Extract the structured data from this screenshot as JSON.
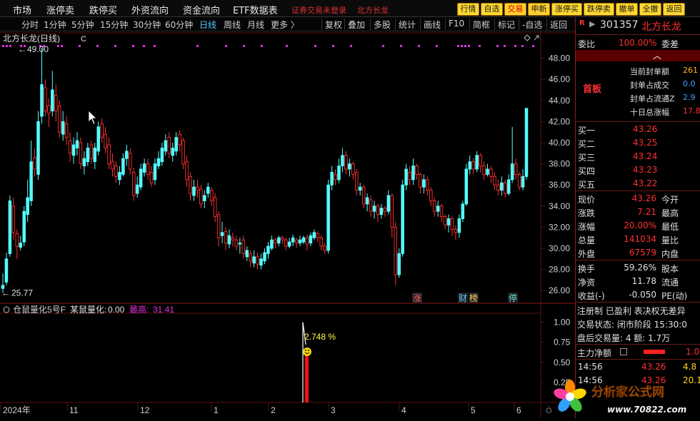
{
  "top_nav": {
    "items": [
      "市场",
      "涨停卖",
      "跌停买",
      "外资流向",
      "资金流向",
      "ETF数据表"
    ],
    "status_text": "证券交易未登录",
    "stock_short": "北方长龙",
    "buttons": [
      "行情",
      "自选",
      "交易",
      "申新",
      "涨停买",
      "跌停卖",
      "撤单",
      "全撤",
      "返回"
    ]
  },
  "toolbar": {
    "periods": [
      "分时",
      "1分钟",
      "5分钟",
      "15分钟",
      "30分钟",
      "60分钟",
      "日线",
      "周线",
      "月线",
      "更多 〉"
    ],
    "active_period": "日线",
    "tools": [
      "复权",
      "叠加",
      "多股",
      "统计",
      "画线",
      "F10",
      "简框",
      "标记",
      "-自选",
      "返回"
    ]
  },
  "chart": {
    "title": "北方长龙(日线)",
    "title_suffix": "C",
    "high_label": "49.00",
    "low_label": "25.77",
    "y_ticks": [
      "48.00",
      "46.00",
      "44.00",
      "42.00",
      "40.00",
      "38.00",
      "36.00",
      "34.00",
      "32.00",
      "30.00",
      "28.00",
      "26.00"
    ],
    "event_tags": [
      "涨",
      "财",
      "榜",
      "停"
    ],
    "x_labels": [
      "2024年",
      "11",
      "12",
      "1",
      "2",
      "3",
      "4",
      "5",
      "6"
    ],
    "indicator_title": "仓鼠量化5号F",
    "indicator_name": "某鼠量化:",
    "indicator_value": "0.00",
    "indicator_high_label": "最高:",
    "indicator_high": "31.41",
    "indicator_ticks": [
      "1.00",
      "0.75",
      "0.50",
      "0.25"
    ],
    "indicator_annotation": "2.748 %",
    "bottom_right_tick": "Ò"
  },
  "chart_data": {
    "type": "candlestick",
    "title": "北方长龙(日线)",
    "ylim": [
      25.0,
      50.0
    ],
    "candles": [
      [
        26.5,
        26.2,
        27.6,
        25.77
      ],
      [
        29.0,
        26.8,
        29.6,
        26.5
      ],
      [
        34.5,
        29.5,
        35.0,
        29.2
      ],
      [
        31.5,
        34.0,
        34.8,
        30.8
      ],
      [
        30.2,
        31.4,
        31.8,
        29.0
      ],
      [
        30.5,
        30.1,
        31.2,
        29.8
      ],
      [
        33.5,
        30.6,
        34.0,
        30.2
      ],
      [
        34.8,
        33.2,
        36.5,
        32.5
      ],
      [
        38.2,
        34.5,
        40.2,
        34.0
      ],
      [
        37.5,
        38.6,
        39.5,
        36.8
      ],
      [
        42.0,
        37.0,
        43.0,
        36.5
      ],
      [
        45.5,
        42.5,
        49.0,
        41.8
      ],
      [
        43.0,
        45.2,
        46.0,
        42.5
      ],
      [
        42.8,
        43.5,
        44.2,
        41.5
      ],
      [
        45.0,
        43.0,
        46.8,
        42.5
      ],
      [
        43.0,
        44.5,
        45.5,
        42.0
      ],
      [
        41.0,
        43.5,
        44.0,
        40.5
      ],
      [
        42.0,
        40.8,
        43.0,
        40.2
      ],
      [
        40.5,
        41.8,
        42.5,
        39.8
      ],
      [
        39.0,
        40.2,
        41.0,
        38.2
      ],
      [
        39.8,
        38.8,
        40.5,
        38.0
      ],
      [
        40.2,
        39.5,
        41.0,
        38.8
      ],
      [
        38.0,
        40.0,
        40.5,
        37.5
      ],
      [
        38.5,
        37.8,
        39.2,
        37.0
      ],
      [
        39.5,
        38.2,
        40.0,
        37.8
      ],
      [
        38.5,
        39.8,
        40.2,
        38.0
      ],
      [
        39.5,
        38.2,
        40.0,
        37.5
      ],
      [
        41.5,
        39.2,
        42.0,
        38.8
      ],
      [
        40.5,
        41.8,
        42.3,
        40.0
      ],
      [
        39.5,
        40.8,
        41.5,
        39.0
      ],
      [
        38.0,
        39.8,
        40.5,
        37.5
      ],
      [
        37.5,
        38.2,
        39.0,
        36.8
      ],
      [
        36.8,
        37.8,
        38.2,
        36.2
      ],
      [
        37.2,
        36.5,
        37.8,
        36.0
      ],
      [
        38.5,
        37.0,
        39.0,
        36.8
      ],
      [
        39.2,
        38.5,
        39.8,
        37.8
      ],
      [
        37.5,
        39.0,
        39.5,
        37.0
      ],
      [
        35.0,
        37.2,
        37.6,
        34.5
      ],
      [
        36.0,
        35.2,
        36.8,
        34.8
      ],
      [
        37.5,
        35.8,
        38.0,
        35.5
      ],
      [
        38.0,
        37.2,
        38.5,
        36.8
      ],
      [
        37.0,
        38.0,
        38.5,
        36.5
      ],
      [
        36.2,
        37.2,
        37.8,
        35.8
      ],
      [
        38.0,
        36.5,
        38.5,
        36.0
      ],
      [
        38.5,
        37.8,
        39.2,
        37.5
      ],
      [
        39.5,
        38.2,
        40.0,
        37.8
      ],
      [
        40.2,
        39.2,
        40.8,
        38.8
      ],
      [
        39.0,
        40.5,
        41.0,
        38.5
      ],
      [
        39.5,
        38.8,
        40.0,
        38.2
      ],
      [
        40.5,
        39.2,
        41.0,
        38.8
      ],
      [
        39.8,
        40.8,
        41.2,
        39.2
      ],
      [
        38.0,
        40.2,
        40.5,
        37.5
      ],
      [
        36.5,
        38.2,
        38.8,
        35.8
      ],
      [
        35.2,
        36.8,
        37.2,
        34.5
      ],
      [
        35.8,
        35.0,
        36.5,
        34.5
      ],
      [
        35.5,
        35.8,
        36.5,
        34.8
      ],
      [
        34.2,
        35.6,
        36.0,
        33.8
      ],
      [
        35.0,
        34.5,
        35.5,
        33.8
      ],
      [
        35.8,
        35.2,
        36.2,
        34.8
      ],
      [
        34.5,
        35.5,
        35.8,
        34.0
      ],
      [
        33.0,
        34.8,
        35.2,
        32.5
      ],
      [
        31.0,
        33.2,
        33.5,
        30.2
      ],
      [
        31.5,
        31.2,
        32.5,
        30.5
      ],
      [
        30.5,
        31.6,
        32.0,
        29.8
      ],
      [
        31.2,
        30.4,
        31.8,
        30.0
      ],
      [
        30.8,
        31.0,
        31.5,
        30.2
      ],
      [
        30.2,
        30.8,
        31.2,
        29.8
      ],
      [
        30.5,
        30.4,
        31.0,
        29.5
      ],
      [
        29.5,
        30.8,
        31.2,
        29.0
      ],
      [
        29.8,
        29.2,
        30.2,
        28.8
      ],
      [
        28.8,
        29.5,
        29.8,
        28.2
      ],
      [
        29.2,
        28.6,
        29.8,
        28.2
      ],
      [
        28.5,
        29.2,
        29.6,
        28.0
      ],
      [
        29.0,
        28.4,
        29.5,
        28.0
      ],
      [
        29.6,
        28.8,
        30.0,
        28.5
      ],
      [
        30.2,
        29.5,
        30.6,
        29.0
      ],
      [
        30.8,
        30.0,
        31.2,
        29.8
      ],
      [
        30.5,
        30.8,
        31.0,
        30.0
      ],
      [
        31.0,
        30.5,
        31.2,
        30.2
      ],
      [
        30.8,
        31.0,
        31.2,
        30.4
      ],
      [
        30.2,
        30.8,
        31.0,
        29.8
      ],
      [
        30.6,
        30.2,
        31.0,
        30.0
      ],
      [
        31.0,
        30.6,
        31.3,
        30.2
      ],
      [
        30.5,
        30.8,
        31.0,
        30.0
      ],
      [
        30.8,
        30.5,
        31.2,
        30.2
      ],
      [
        31.0,
        30.6,
        31.2,
        30.4
      ],
      [
        30.4,
        31.0,
        31.3,
        29.8
      ],
      [
        31.2,
        30.5,
        31.5,
        30.2
      ],
      [
        31.5,
        31.0,
        31.8,
        30.8
      ],
      [
        31.0,
        31.4,
        31.6,
        30.6
      ],
      [
        30.2,
        31.0,
        31.2,
        29.8
      ],
      [
        29.8,
        30.2,
        30.5,
        29.5
      ],
      [
        36.0,
        29.8,
        36.5,
        29.5
      ],
      [
        37.2,
        36.0,
        37.8,
        35.5
      ],
      [
        36.5,
        37.0,
        37.5,
        36.0
      ],
      [
        37.8,
        36.5,
        38.5,
        36.2
      ],
      [
        38.8,
        37.8,
        39.5,
        37.2
      ],
      [
        37.5,
        38.8,
        39.2,
        37.0
      ],
      [
        38.0,
        37.5,
        38.5,
        36.8
      ],
      [
        37.0,
        38.0,
        38.2,
        36.5
      ],
      [
        35.5,
        37.2,
        37.5,
        35.0
      ],
      [
        35.8,
        35.5,
        36.2,
        35.0
      ],
      [
        34.2,
        35.8,
        36.0,
        33.8
      ],
      [
        34.8,
        34.2,
        35.2,
        33.5
      ],
      [
        33.5,
        34.6,
        35.0,
        33.0
      ],
      [
        34.0,
        33.5,
        34.5,
        32.8
      ],
      [
        33.2,
        34.0,
        34.2,
        32.5
      ],
      [
        33.8,
        33.2,
        34.2,
        32.8
      ],
      [
        33.5,
        33.8,
        34.0,
        33.0
      ],
      [
        35.0,
        33.5,
        35.5,
        33.2
      ],
      [
        32.0,
        35.0,
        35.2,
        31.0
      ],
      [
        27.5,
        32.0,
        32.5,
        26.5
      ],
      [
        29.5,
        27.5,
        30.0,
        27.2
      ],
      [
        36.0,
        29.5,
        36.5,
        29.2
      ],
      [
        37.5,
        36.0,
        38.0,
        35.5
      ],
      [
        36.5,
        37.2,
        37.8,
        36.0
      ],
      [
        37.8,
        36.5,
        38.5,
        36.0
      ],
      [
        37.0,
        37.8,
        38.0,
        36.5
      ],
      [
        35.8,
        37.0,
        37.2,
        35.2
      ],
      [
        36.5,
        35.8,
        37.0,
        35.2
      ],
      [
        35.5,
        36.5,
        36.8,
        35.0
      ],
      [
        34.5,
        35.5,
        35.8,
        34.0
      ],
      [
        33.5,
        34.5,
        34.8,
        33.0
      ],
      [
        34.0,
        33.5,
        34.5,
        33.0
      ],
      [
        33.0,
        34.0,
        34.2,
        32.5
      ],
      [
        32.2,
        33.0,
        33.2,
        31.8
      ],
      [
        32.8,
        32.2,
        33.2,
        31.5
      ],
      [
        31.8,
        32.8,
        33.0,
        31.2
      ],
      [
        31.5,
        31.8,
        32.2,
        30.8
      ],
      [
        32.8,
        31.5,
        33.2,
        31.0
      ],
      [
        34.2,
        32.8,
        34.5,
        32.5
      ],
      [
        37.5,
        34.2,
        38.0,
        34.0
      ],
      [
        38.2,
        37.5,
        38.8,
        37.0
      ],
      [
        37.5,
        38.2,
        38.5,
        37.0
      ],
      [
        38.8,
        37.5,
        39.2,
        37.2
      ],
      [
        37.8,
        38.8,
        39.0,
        37.2
      ],
      [
        37.0,
        37.8,
        38.2,
        36.5
      ],
      [
        37.5,
        37.0,
        38.0,
        36.8
      ],
      [
        36.8,
        37.5,
        37.8,
        36.2
      ],
      [
        36.0,
        36.8,
        37.2,
        35.5
      ],
      [
        35.5,
        36.0,
        36.5,
        35.0
      ],
      [
        36.2,
        35.5,
        36.8,
        35.0
      ],
      [
        35.2,
        36.2,
        36.5,
        34.8
      ],
      [
        36.5,
        35.2,
        37.0,
        35.0
      ],
      [
        38.0,
        36.5,
        41.5,
        36.2
      ],
      [
        37.0,
        38.0,
        38.5,
        36.5
      ],
      [
        35.8,
        37.0,
        37.2,
        35.5
      ],
      [
        36.8,
        35.8,
        37.5,
        35.5
      ],
      [
        43.26,
        36.8,
        43.26,
        36.5
      ]
    ]
  },
  "right_panel": {
    "code": "301357",
    "name": "北方长龙",
    "badge": "R",
    "wei_bi_label": "委比",
    "wei_bi_value": "100.00%",
    "wei_cha_label": "委差",
    "board_label": "首板",
    "board_stats": [
      {
        "label": "当前封单额",
        "value": "261"
      },
      {
        "label": "封单占成交",
        "value": "0.0"
      },
      {
        "label": "封单占流通Z",
        "value": "2.9"
      },
      {
        "label": "十日总涨幅",
        "value": "17.8"
      }
    ],
    "buy_levels": [
      {
        "label": "买一",
        "price": "43.26"
      },
      {
        "label": "买二",
        "price": "43.25"
      },
      {
        "label": "买三",
        "price": "43.24"
      },
      {
        "label": "买四",
        "price": "43.23"
      },
      {
        "label": "买五",
        "price": "43.22"
      }
    ],
    "quote_rows": [
      {
        "label": "现价",
        "value": "43.26",
        "label2": "今开"
      },
      {
        "label": "涨跌",
        "value": "7.21",
        "label2": "最高"
      },
      {
        "label": "涨幅",
        "value": "20.00%",
        "label2": "最低"
      },
      {
        "label": "总量",
        "value": "141034",
        "label2": "量比"
      },
      {
        "label": "外盘",
        "value": "67579",
        "label2": "内盘"
      }
    ],
    "stat_rows": [
      {
        "label": "换手",
        "value": "59.26%",
        "label2": "股本"
      },
      {
        "label": "净资",
        "value": "11.78",
        "label2": "流通"
      },
      {
        "label": "收益(-)",
        "value": "-0.050",
        "label2": "PE(动)"
      }
    ],
    "info_line": "注册制 已盈利 表决权无差异",
    "trade_status": "交易状态: 闭市阶段 15:30:0",
    "after_hours": "盘后交易量: 4  额: 1.7万",
    "main_flow_label": "主力净额",
    "main_flow_value": "1.0",
    "ticks": [
      {
        "time": "14:56",
        "price": "43.26",
        "vol": "4.8"
      },
      {
        "time": "14:56",
        "price": "43.26",
        "vol": "20.1"
      }
    ]
  },
  "watermark": {
    "text": "分析家公式网",
    "url": "www.70822.com"
  },
  "colors": {
    "up": "#ff3030",
    "down": "#54ffff",
    "grid": "#5a1010",
    "magenta": "#e030e0",
    "yellow_btn": "#ffd830"
  }
}
